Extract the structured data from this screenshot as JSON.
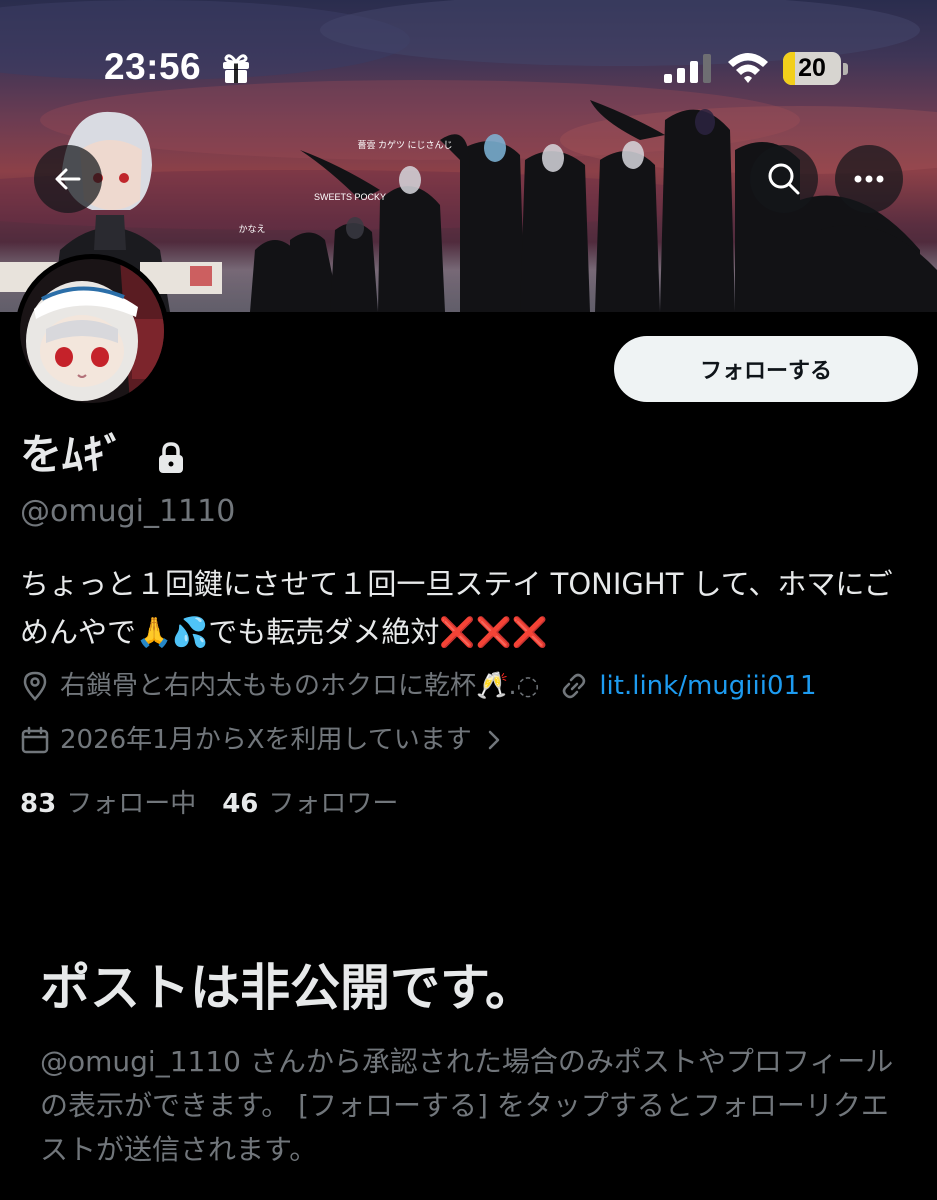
{
  "status_bar": {
    "time": "23:56",
    "battery_level": "20",
    "battery_fraction": 0.2
  },
  "banner": {
    "labels": {
      "sweets": "SWEETS POCKY",
      "kagetsu": "薔雲 カゲツ にじさんじ",
      "kanae": "かなえ"
    },
    "colors": {
      "sky_top": "#2a2d4e",
      "sky_bottom": "#8c4048"
    }
  },
  "nav": {
    "back_icon": "arrow-left-icon",
    "search_icon": "search-icon",
    "more_icon": "more-icon"
  },
  "profile": {
    "display_name": "をﾑｷﾞ",
    "handle": "@omugi_1110",
    "follow_button": "フォローする",
    "bio": "ちょっと１回鍵にさせて１回一旦ステイ TONIGHT して、ホマにごめんやで🙏💦でも転売ダメ絶対❌❌❌",
    "location": "右鎖骨と右内太もものホクロに乾杯🥂.◌",
    "website": "lit.link/mugiii011",
    "joined": "2026年1月からXを利用しています",
    "following_count": "83",
    "following_label": "フォロー中",
    "followers_count": "46",
    "followers_label": "フォロワー"
  },
  "private_notice": {
    "title": "ポストは非公開です。",
    "description": "@omugi_1110 さんから承認された場合のみポストやプロフィールの表示ができます。 [フォローする] をタップするとフォローリクエストが送信されます。"
  },
  "colors": {
    "background": "#000000",
    "text_primary": "#e7e9ea",
    "text_secondary": "#71767b",
    "link": "#1d9bf0",
    "button_bg": "#eff3f4",
    "battery_fill": "#f2cf1b"
  }
}
